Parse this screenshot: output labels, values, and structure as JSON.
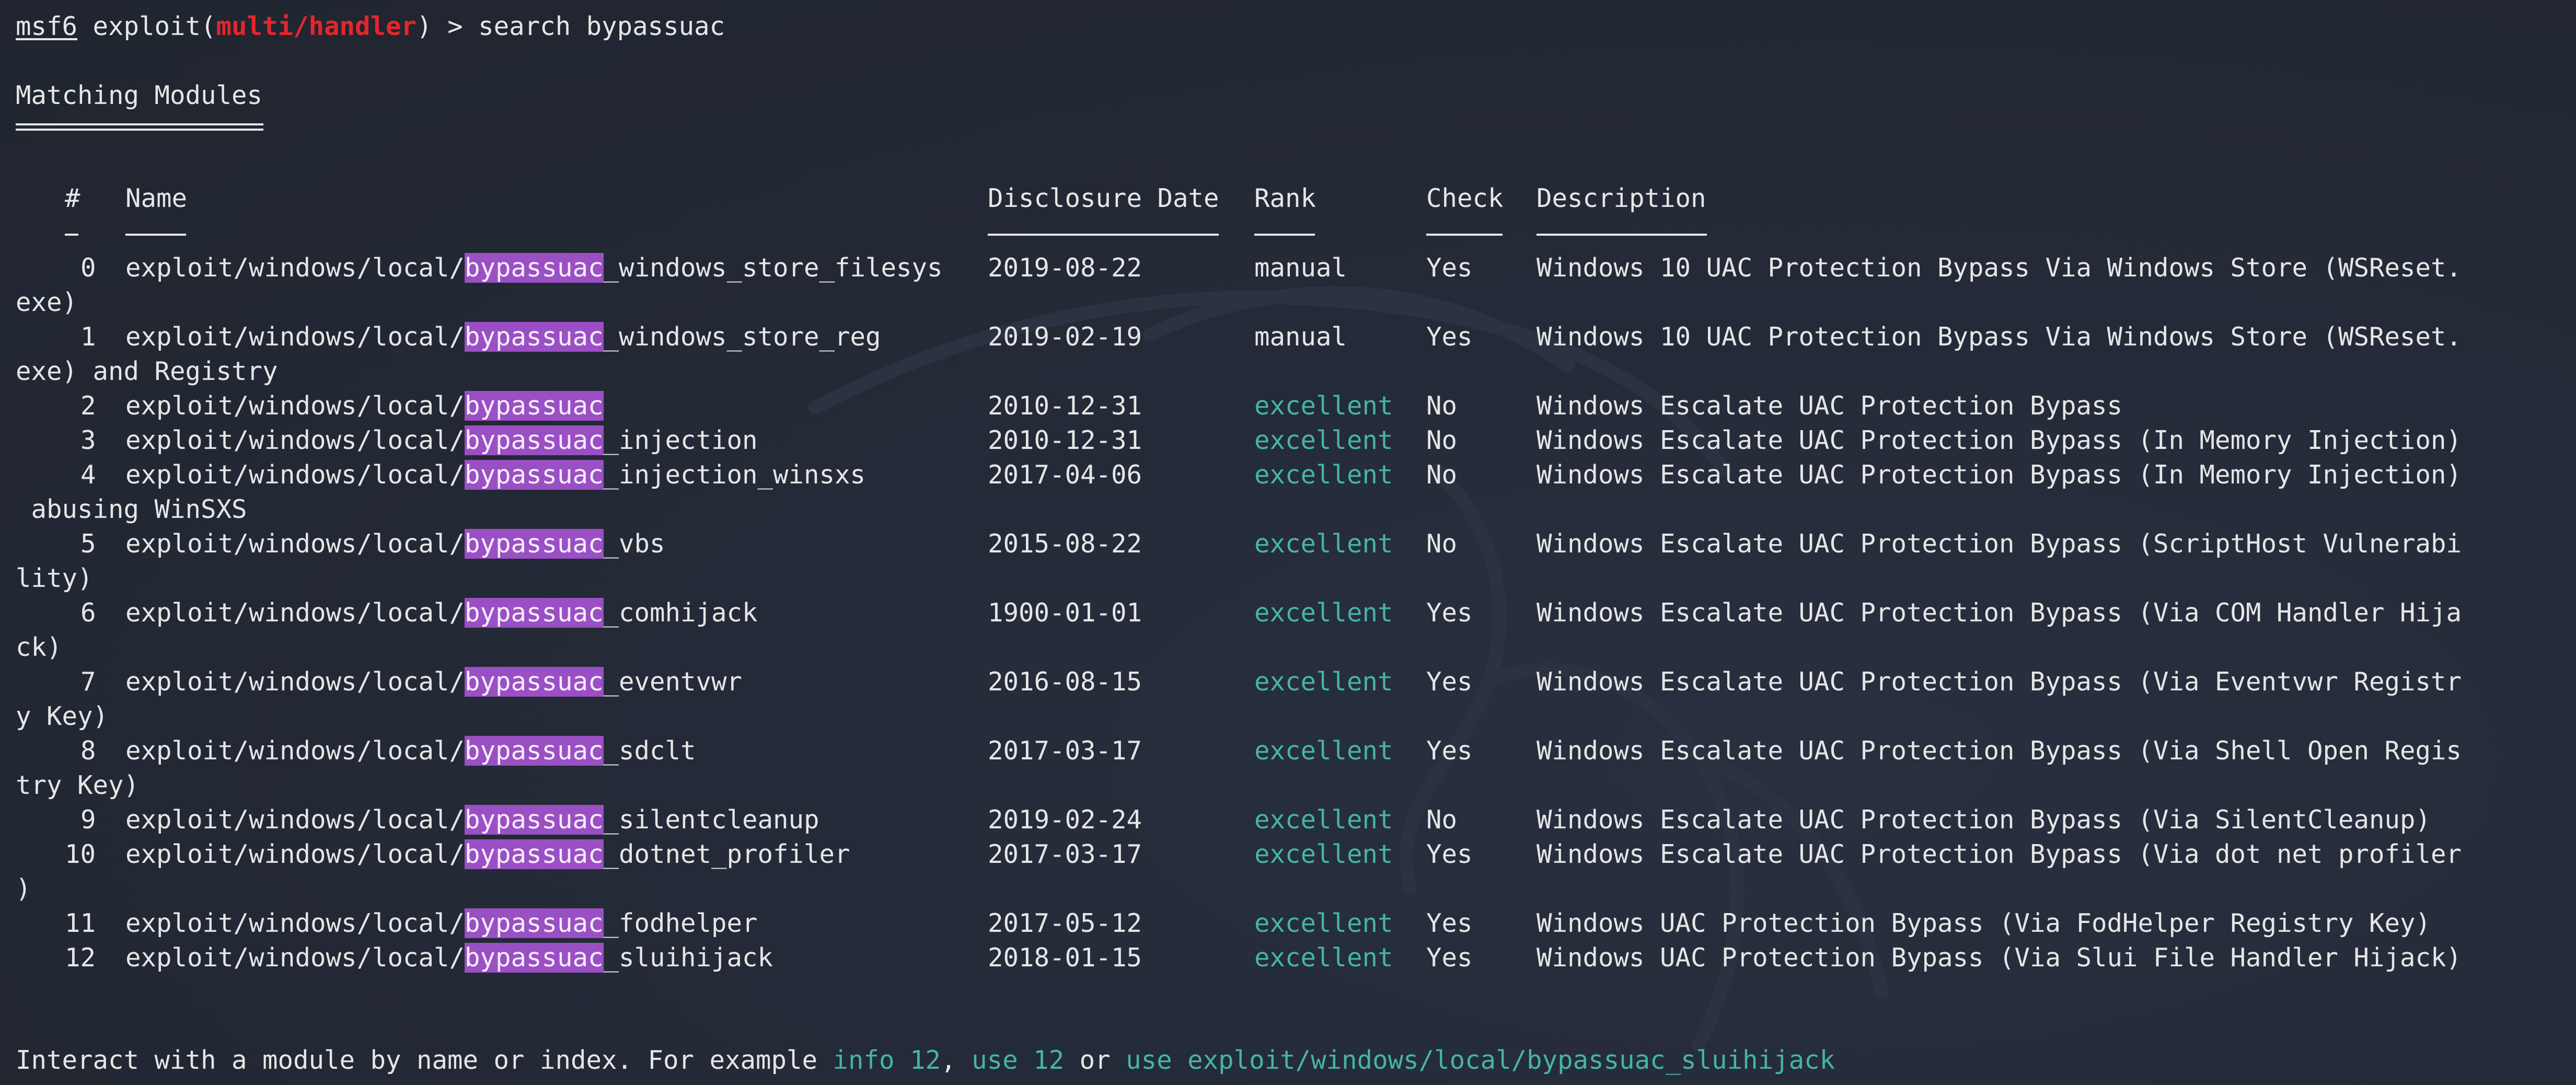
{
  "prompt": {
    "console": "msf6",
    "cmd_prefix": "exploit(",
    "module": "multi/handler",
    "cmd_suffix": ")",
    "arrow": ">",
    "command": "search bypassuac"
  },
  "title": "Matching Modules",
  "columns": {
    "num": "#",
    "name": "Name",
    "date": "Disclosure Date",
    "rank": "Rank",
    "check": "Check",
    "description": "Description"
  },
  "name_prefix": "exploit/windows/local/",
  "highlight": "bypassuac",
  "rows": [
    {
      "num": "0",
      "suffix": "_windows_store_filesys",
      "date": "2019-08-22",
      "rank": "manual",
      "check": "Yes",
      "description": "Windows 10 UAC Protection Bypass Via Windows Store (WSReset.",
      "wrap": "exe)"
    },
    {
      "num": "1",
      "suffix": "_windows_store_reg",
      "date": "2019-02-19",
      "rank": "manual",
      "check": "Yes",
      "description": "Windows 10 UAC Protection Bypass Via Windows Store (WSReset.",
      "wrap": "exe) and Registry"
    },
    {
      "num": "2",
      "suffix": "",
      "date": "2010-12-31",
      "rank": "excellent",
      "check": "No",
      "description": "Windows Escalate UAC Protection Bypass",
      "wrap": ""
    },
    {
      "num": "3",
      "suffix": "_injection",
      "date": "2010-12-31",
      "rank": "excellent",
      "check": "No",
      "description": "Windows Escalate UAC Protection Bypass (In Memory Injection)",
      "wrap": ""
    },
    {
      "num": "4",
      "suffix": "_injection_winsxs",
      "date": "2017-04-06",
      "rank": "excellent",
      "check": "No",
      "description": "Windows Escalate UAC Protection Bypass (In Memory Injection)",
      "wrap": " abusing WinSXS"
    },
    {
      "num": "5",
      "suffix": "_vbs",
      "date": "2015-08-22",
      "rank": "excellent",
      "check": "No",
      "description": "Windows Escalate UAC Protection Bypass (ScriptHost Vulnerabi",
      "wrap": "lity)"
    },
    {
      "num": "6",
      "suffix": "_comhijack",
      "date": "1900-01-01",
      "rank": "excellent",
      "check": "Yes",
      "description": "Windows Escalate UAC Protection Bypass (Via COM Handler Hija",
      "wrap": "ck)"
    },
    {
      "num": "7",
      "suffix": "_eventvwr",
      "date": "2016-08-15",
      "rank": "excellent",
      "check": "Yes",
      "description": "Windows Escalate UAC Protection Bypass (Via Eventvwr Registr",
      "wrap": "y Key)"
    },
    {
      "num": "8",
      "suffix": "_sdclt",
      "date": "2017-03-17",
      "rank": "excellent",
      "check": "Yes",
      "description": "Windows Escalate UAC Protection Bypass (Via Shell Open Regis",
      "wrap": "try Key)"
    },
    {
      "num": "9",
      "suffix": "_silentcleanup",
      "date": "2019-02-24",
      "rank": "excellent",
      "check": "No",
      "description": "Windows Escalate UAC Protection Bypass (Via SilentCleanup)",
      "wrap": ""
    },
    {
      "num": "10",
      "suffix": "_dotnet_profiler",
      "date": "2017-03-17",
      "rank": "excellent",
      "check": "Yes",
      "description": "Windows Escalate UAC Protection Bypass (Via dot net profiler",
      "wrap": ")"
    },
    {
      "num": "11",
      "suffix": "_fodhelper",
      "date": "2017-05-12",
      "rank": "excellent",
      "check": "Yes",
      "description": "Windows UAC Protection Bypass (Via FodHelper Registry Key)",
      "wrap": ""
    },
    {
      "num": "12",
      "suffix": "_sluihijack",
      "date": "2018-01-15",
      "rank": "excellent",
      "check": "Yes",
      "description": "Windows UAC Protection Bypass (Via Slui File Handler Hijack)",
      "wrap": ""
    }
  ],
  "footer": {
    "text1": "Interact with a module by name or index. For example ",
    "link1": "info 12",
    "text2": ", ",
    "link2": "use 12",
    "text3": " or ",
    "link3": "use exploit/windows/local/bypassuac_sluihijack"
  },
  "colors": {
    "background": "#232935",
    "text": "#e6e6e6",
    "prompt_module": "#e4262c",
    "highlight": "#9b4fc4",
    "rank_excellent": "#46b3a8",
    "links": "#46b3a8"
  }
}
